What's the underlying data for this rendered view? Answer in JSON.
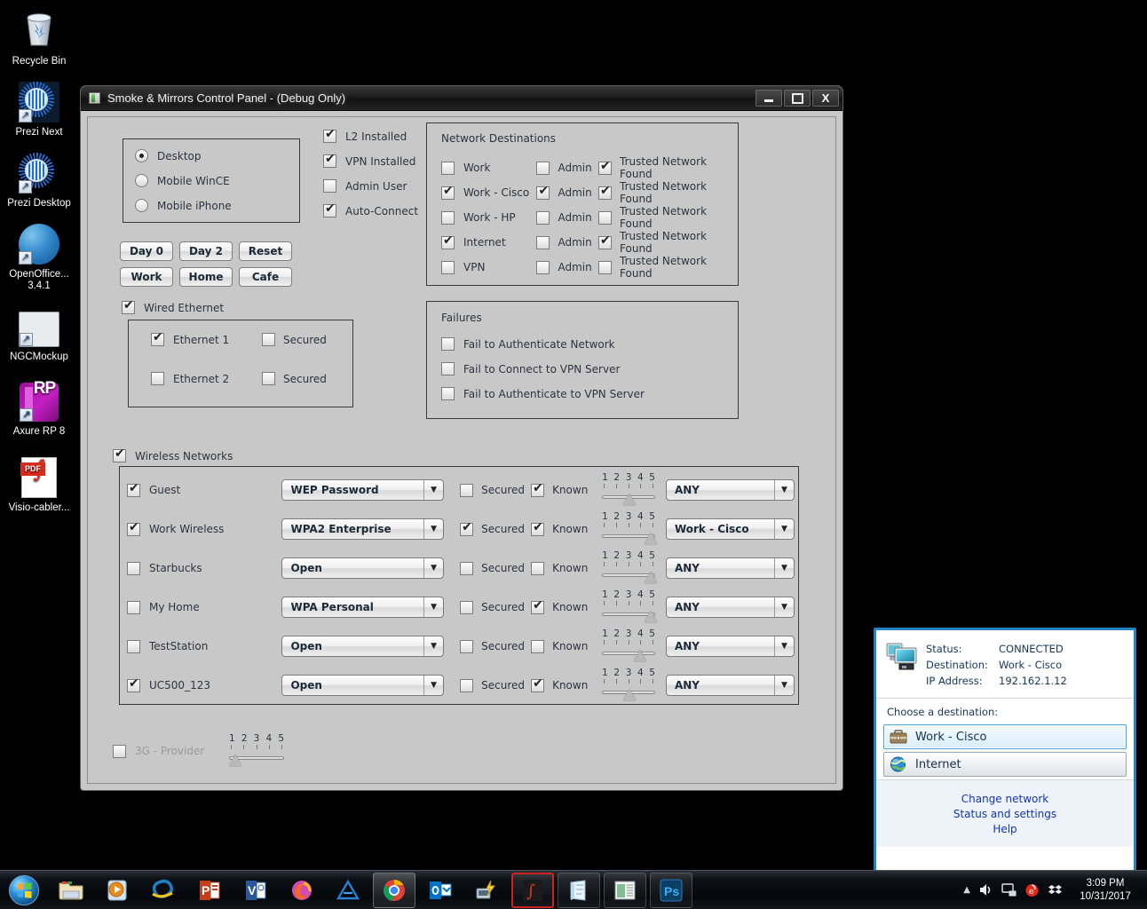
{
  "desktop": {
    "icons": [
      {
        "label": "Recycle Bin",
        "icon": "recycle-bin-icon"
      },
      {
        "label": "Prezi Next",
        "icon": "prezi-next-icon"
      },
      {
        "label": "Prezi Desktop",
        "icon": "prezi-desktop-icon"
      },
      {
        "label": "OpenOffice... 3.4.1",
        "icon": "openoffice-icon"
      },
      {
        "label": "NGCMockup",
        "icon": "ngcmockup-icon"
      },
      {
        "label": "Axure RP 8",
        "icon": "axure-rp8-icon"
      },
      {
        "label": "Visio-cabler...",
        "icon": "pdf-file-icon"
      }
    ]
  },
  "window": {
    "title": "Smoke & Mirrors Control Panel - (Debug Only)",
    "minimize_label": "",
    "maximize_label": "",
    "close_label": "X"
  },
  "device_modes": {
    "options": [
      {
        "label": "Desktop",
        "selected": true
      },
      {
        "label": "Mobile WinCE",
        "selected": false
      },
      {
        "label": "Mobile iPhone",
        "selected": false
      }
    ]
  },
  "install_flags": [
    {
      "label": "L2 Installed",
      "checked": true
    },
    {
      "label": "VPN Installed",
      "checked": true
    },
    {
      "label": "Admin User",
      "checked": false
    },
    {
      "label": "Auto-Connect",
      "checked": true
    }
  ],
  "scenario_buttons": [
    {
      "label": "Day 0"
    },
    {
      "label": "Day 2"
    },
    {
      "label": "Reset"
    },
    {
      "label": "Work"
    },
    {
      "label": "Home"
    },
    {
      "label": "Cafe"
    }
  ],
  "network_destinations": {
    "title": "Network Destinations",
    "admin_label": "Admin",
    "trusted_label": "Trusted Network Found",
    "rows": [
      {
        "name": "Work",
        "enabled": false,
        "admin": false,
        "trusted": true
      },
      {
        "name": "Work - Cisco",
        "enabled": true,
        "admin": true,
        "trusted": true
      },
      {
        "name": "Work - HP",
        "enabled": false,
        "admin": false,
        "trusted": false
      },
      {
        "name": "Internet",
        "enabled": true,
        "admin": false,
        "trusted": true
      },
      {
        "name": "VPN",
        "enabled": false,
        "admin": false,
        "trusted": false
      }
    ]
  },
  "failures": {
    "title": "Failures",
    "rows": [
      {
        "label": "Fail to Authenticate Network",
        "checked": false
      },
      {
        "label": "Fail to Connect to VPN Server",
        "checked": false
      },
      {
        "label": "Fail to Authenticate to VPN Server",
        "checked": false
      }
    ]
  },
  "wired": {
    "section_label": "Wired Ethernet",
    "section_checked": true,
    "secured_label": "Secured",
    "rows": [
      {
        "name": "Ethernet 1",
        "enabled": true,
        "secured": false
      },
      {
        "name": "Ethernet 2",
        "enabled": false,
        "secured": false
      }
    ]
  },
  "wireless": {
    "section_label": "Wireless Networks",
    "section_checked": true,
    "secured_label": "Secured",
    "known_label": "Known",
    "signal_ticks": [
      "1",
      "2",
      "3",
      "4",
      "5"
    ],
    "rows": [
      {
        "name": "Guest",
        "enabled": true,
        "security": "WEP Password",
        "secured": false,
        "known": true,
        "signal": 3,
        "destination": "ANY"
      },
      {
        "name": "Work Wireless",
        "enabled": true,
        "security": "WPA2 Enterprise",
        "secured": true,
        "known": true,
        "signal": 5,
        "destination": "Work - Cisco"
      },
      {
        "name": "Starbucks",
        "enabled": false,
        "security": "Open",
        "secured": false,
        "known": false,
        "signal": 5,
        "destination": "ANY"
      },
      {
        "name": "My Home",
        "enabled": false,
        "security": "WPA Personal",
        "secured": false,
        "known": true,
        "signal": 5,
        "destination": "ANY"
      },
      {
        "name": "TestStation",
        "enabled": false,
        "security": "Open",
        "secured": false,
        "known": false,
        "signal": 4,
        "destination": "ANY"
      },
      {
        "name": "UC500_123",
        "enabled": true,
        "security": "Open",
        "secured": false,
        "known": true,
        "signal": 3,
        "destination": "ANY"
      }
    ]
  },
  "cellular": {
    "label": "3G - Provider",
    "checked": false,
    "signal": 1,
    "signal_ticks": [
      "1",
      "2",
      "3",
      "4",
      "5"
    ]
  },
  "flyout": {
    "status_key": "Status:",
    "status_value": "CONNECTED",
    "destination_key": "Destination:",
    "destination_value": "Work - Cisco",
    "ip_key": "IP Address:",
    "ip_value": "192.162.1.12",
    "choose_label": "Choose a destination:",
    "destinations": [
      {
        "label": "Work - Cisco",
        "icon": "briefcase-icon",
        "selected": true
      },
      {
        "label": "Internet",
        "icon": "globe-icon",
        "selected": false
      }
    ],
    "links": [
      {
        "label": "Change network"
      },
      {
        "label": "Status and settings"
      },
      {
        "label": "Help"
      }
    ]
  },
  "taskbar": {
    "start_label": "Start",
    "apps": [
      {
        "name": "windows-explorer-icon",
        "active": false
      },
      {
        "name": "windows-media-player-icon",
        "active": false
      },
      {
        "name": "internet-explorer-icon",
        "active": false
      },
      {
        "name": "powerpoint-icon",
        "active": false
      },
      {
        "name": "visio-icon",
        "active": false
      },
      {
        "name": "firefox-icon",
        "active": false
      },
      {
        "name": "autocad-icon",
        "active": false
      },
      {
        "name": "chrome-icon",
        "active": true
      },
      {
        "name": "outlook-icon",
        "active": false
      },
      {
        "name": "network-tool-icon",
        "active": false
      },
      {
        "name": "acrobat-icon",
        "active": true
      },
      {
        "name": "onenote-icon",
        "active": false
      },
      {
        "name": "snipping-tool-icon",
        "active": false
      },
      {
        "name": "photoshop-icon",
        "active": false
      }
    ],
    "tray": [
      {
        "name": "show-hidden-icons-icon"
      },
      {
        "name": "volume-icon"
      },
      {
        "name": "network-icon"
      },
      {
        "name": "security-icon"
      },
      {
        "name": "dropbox-icon"
      }
    ],
    "time": "3:09 PM",
    "date": "10/31/2017"
  },
  "colors": {
    "panel_bg": "#c8c8c8",
    "accent": "#2183c4",
    "link": "#1136b5",
    "text": "#2b3440"
  }
}
